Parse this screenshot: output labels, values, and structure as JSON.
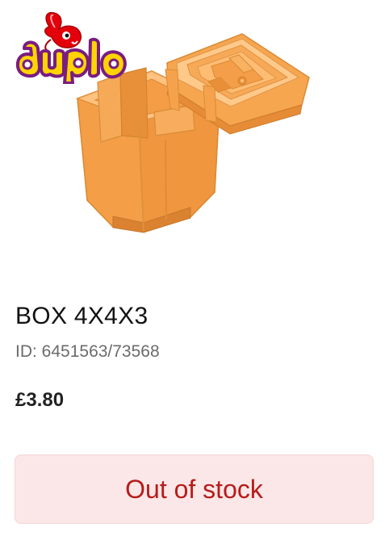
{
  "product": {
    "brand_logo_text": "duplo",
    "image_icon": "orange-box-with-hinged-lid",
    "title": "BOX 4X4X3",
    "id_text": "ID: 6451563/73568",
    "price": "£3.80",
    "stock_status": "Out of stock"
  },
  "colors": {
    "box_orange": "#F7A34B",
    "box_shadow": "#E58E2E",
    "logo_yellow": "#FFD400",
    "logo_red": "#E3000B",
    "logo_purple": "#7A1D7F",
    "status_text": "#B71B1B",
    "status_background": "#FBE7E7"
  }
}
